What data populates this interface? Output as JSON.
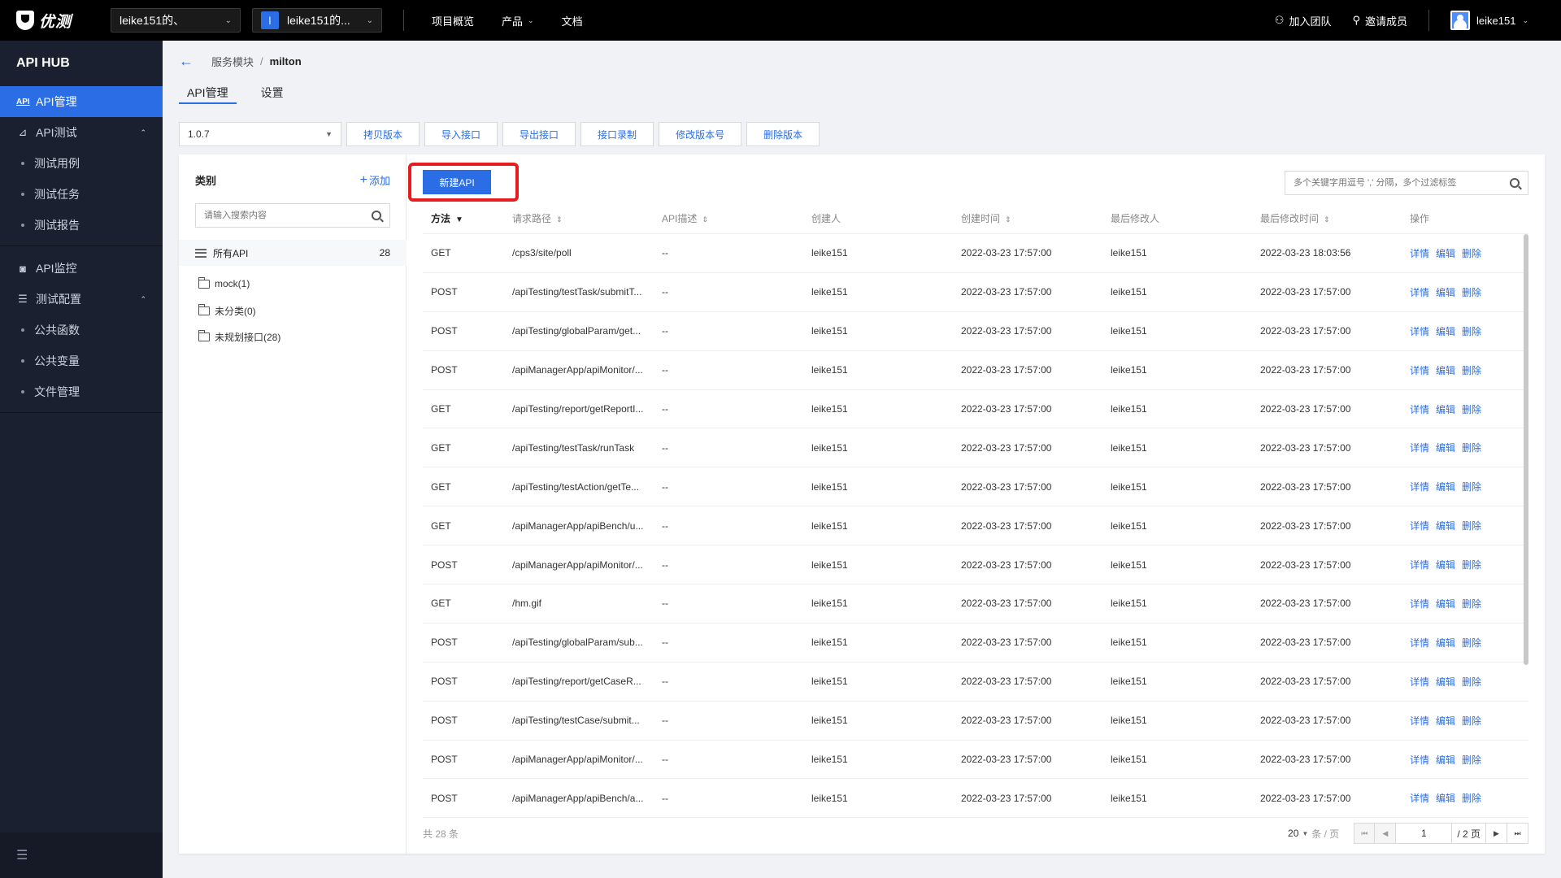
{
  "topbar": {
    "logo_text": "优测",
    "org_select": "leike151的、",
    "project_initial": "l",
    "project_select": "leike151的...",
    "nav": [
      {
        "label": "项目概览",
        "has_caret": false
      },
      {
        "label": "产品",
        "has_caret": true
      },
      {
        "label": "文档",
        "has_caret": false
      }
    ],
    "join_team": "加入团队",
    "invite_member": "邀请成员",
    "username": "leike151"
  },
  "sidebar": {
    "title": "API HUB",
    "api_manage_icon": "API",
    "api_manage": "API管理",
    "api_test": "API测试",
    "api_test_children": [
      "测试用例",
      "测试任务",
      "测试报告"
    ],
    "api_monitor": "API监控",
    "test_config": "测试配置",
    "test_config_children": [
      "公共函数",
      "公共变量",
      "文件管理"
    ]
  },
  "breadcrumb": {
    "parent": "服务模块",
    "separator": "/",
    "current": "milton"
  },
  "tabs": [
    "API管理",
    "设置"
  ],
  "toolbar": {
    "version": "1.0.7",
    "buttons": [
      "拷贝版本",
      "导入接口",
      "导出接口",
      "接口录制",
      "修改版本号",
      "删除版本"
    ]
  },
  "category": {
    "title": "类别",
    "add_label": "添加",
    "search_placeholder": "请输入搜索内容",
    "all_label": "所有API",
    "all_count": "28",
    "folders": [
      "mock(1)",
      "未分类(0)",
      "未规划接口(28)"
    ]
  },
  "main": {
    "new_api": "新建API",
    "filter_placeholder": "多个关键字用逗号 ',' 分隔，多个过滤标签"
  },
  "table": {
    "headers": {
      "method": "方法",
      "path": "请求路径",
      "desc": "API描述",
      "creator": "创建人",
      "created": "创建时间",
      "modifier": "最后修改人",
      "modified": "最后修改时间",
      "ops": "操作"
    },
    "ops": {
      "detail": "详情",
      "edit": "编辑",
      "delete": "删除"
    },
    "rows": [
      {
        "method": "GET",
        "path": "/cps3/site/poll",
        "desc": "--",
        "creator": "leike151",
        "created": "2022-03-23 17:57:00",
        "modifier": "leike151",
        "modified": "2022-03-23 18:03:56"
      },
      {
        "method": "POST",
        "path": "/apiTesting/testTask/submitT...",
        "desc": "--",
        "creator": "leike151",
        "created": "2022-03-23 17:57:00",
        "modifier": "leike151",
        "modified": "2022-03-23 17:57:00"
      },
      {
        "method": "POST",
        "path": "/apiTesting/globalParam/get...",
        "desc": "--",
        "creator": "leike151",
        "created": "2022-03-23 17:57:00",
        "modifier": "leike151",
        "modified": "2022-03-23 17:57:00"
      },
      {
        "method": "POST",
        "path": "/apiManagerApp/apiMonitor/...",
        "desc": "--",
        "creator": "leike151",
        "created": "2022-03-23 17:57:00",
        "modifier": "leike151",
        "modified": "2022-03-23 17:57:00"
      },
      {
        "method": "GET",
        "path": "/apiTesting/report/getReportI...",
        "desc": "--",
        "creator": "leike151",
        "created": "2022-03-23 17:57:00",
        "modifier": "leike151",
        "modified": "2022-03-23 17:57:00"
      },
      {
        "method": "GET",
        "path": "/apiTesting/testTask/runTask",
        "desc": "--",
        "creator": "leike151",
        "created": "2022-03-23 17:57:00",
        "modifier": "leike151",
        "modified": "2022-03-23 17:57:00"
      },
      {
        "method": "GET",
        "path": "/apiTesting/testAction/getTe...",
        "desc": "--",
        "creator": "leike151",
        "created": "2022-03-23 17:57:00",
        "modifier": "leike151",
        "modified": "2022-03-23 17:57:00"
      },
      {
        "method": "GET",
        "path": "/apiManagerApp/apiBench/u...",
        "desc": "--",
        "creator": "leike151",
        "created": "2022-03-23 17:57:00",
        "modifier": "leike151",
        "modified": "2022-03-23 17:57:00"
      },
      {
        "method": "POST",
        "path": "/apiManagerApp/apiMonitor/...",
        "desc": "--",
        "creator": "leike151",
        "created": "2022-03-23 17:57:00",
        "modifier": "leike151",
        "modified": "2022-03-23 17:57:00"
      },
      {
        "method": "GET",
        "path": "/hm.gif",
        "desc": "--",
        "creator": "leike151",
        "created": "2022-03-23 17:57:00",
        "modifier": "leike151",
        "modified": "2022-03-23 17:57:00"
      },
      {
        "method": "POST",
        "path": "/apiTesting/globalParam/sub...",
        "desc": "--",
        "creator": "leike151",
        "created": "2022-03-23 17:57:00",
        "modifier": "leike151",
        "modified": "2022-03-23 17:57:00"
      },
      {
        "method": "POST",
        "path": "/apiTesting/report/getCaseR...",
        "desc": "--",
        "creator": "leike151",
        "created": "2022-03-23 17:57:00",
        "modifier": "leike151",
        "modified": "2022-03-23 17:57:00"
      },
      {
        "method": "POST",
        "path": "/apiTesting/testCase/submit...",
        "desc": "--",
        "creator": "leike151",
        "created": "2022-03-23 17:57:00",
        "modifier": "leike151",
        "modified": "2022-03-23 17:57:00"
      },
      {
        "method": "POST",
        "path": "/apiManagerApp/apiMonitor/...",
        "desc": "--",
        "creator": "leike151",
        "created": "2022-03-23 17:57:00",
        "modifier": "leike151",
        "modified": "2022-03-23 17:57:00"
      },
      {
        "method": "POST",
        "path": "/apiManagerApp/apiBench/a...",
        "desc": "--",
        "creator": "leike151",
        "created": "2022-03-23 17:57:00",
        "modifier": "leike151",
        "modified": "2022-03-23 17:57:00"
      }
    ]
  },
  "pagination": {
    "total_text": "共 28 条",
    "page_size": "20",
    "page_size_unit": "条 / 页",
    "current_page": "1",
    "total_pages": "/ 2 页"
  },
  "colors": {
    "accent": "#2b6de4",
    "highlight_border": "#e81c1c",
    "sidebar_bg": "#1b2030",
    "topbar_bg": "#000000"
  }
}
